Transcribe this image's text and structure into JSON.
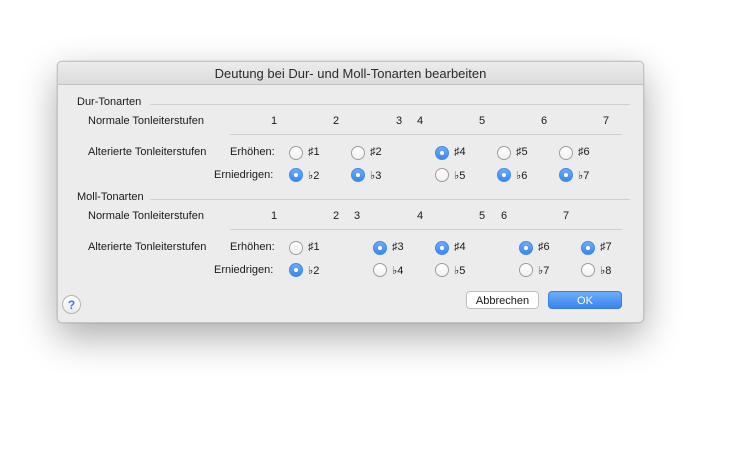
{
  "dialog": {
    "title": "Deutung bei Dur- und Moll-Tonarten bearbeiten",
    "help_label": "?",
    "cancel_label": "Abbrechen",
    "ok_label": "OK"
  },
  "major": {
    "section_title": "Dur-Tonarten",
    "normal_label": "Normale Tonleiterstufen",
    "altered_label": "Alterierte Tonleiterstufen",
    "raise_label": "Erhöhen:",
    "lower_label": "Erniedrigen:",
    "degrees": [
      "1",
      "2",
      "3",
      "4",
      "5",
      "6",
      "7"
    ],
    "raise_options": [
      {
        "label": "♯1",
        "selected": false
      },
      {
        "label": "♯2",
        "selected": false
      },
      {
        "label": "♯4",
        "selected": true
      },
      {
        "label": "♯5",
        "selected": false
      },
      {
        "label": "♯6",
        "selected": false
      }
    ],
    "lower_options": [
      {
        "label": "♭2",
        "selected": true
      },
      {
        "label": "♭3",
        "selected": true
      },
      {
        "label": "♭5",
        "selected": false
      },
      {
        "label": "♭6",
        "selected": true
      },
      {
        "label": "♭7",
        "selected": true
      }
    ]
  },
  "minor": {
    "section_title": "Moll-Tonarten",
    "normal_label": "Normale Tonleiterstufen",
    "altered_label": "Alterierte Tonleiterstufen",
    "raise_label": "Erhöhen:",
    "lower_label": "Erniedrigen:",
    "degrees": [
      "1",
      "2",
      "3",
      "4",
      "5",
      "6",
      "7"
    ],
    "raise_options": [
      {
        "label": "♯1",
        "selected": false
      },
      {
        "label": "♯3",
        "selected": true
      },
      {
        "label": "♯4",
        "selected": true
      },
      {
        "label": "♯6",
        "selected": true
      },
      {
        "label": "♯7",
        "selected": true
      }
    ],
    "lower_options": [
      {
        "label": "♭2",
        "selected": true
      },
      {
        "label": "♭4",
        "selected": false
      },
      {
        "label": "♭5",
        "selected": false
      },
      {
        "label": "♭7",
        "selected": false
      },
      {
        "label": "♭8",
        "selected": false
      }
    ]
  },
  "colors": {
    "accent": "#3d86ee",
    "dialog_background": "#ececec"
  }
}
